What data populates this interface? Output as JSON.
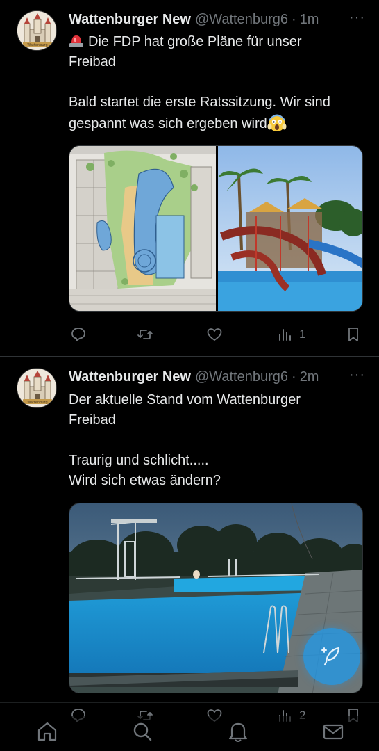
{
  "tweets": [
    {
      "author_name": "Wattenburger New",
      "handle": "@Wattenburg6",
      "separator": "·",
      "time": "1m",
      "more": "···",
      "avatar_label": "Wattenburg",
      "lines": [
        "Die FDP hat große Pläne für unser",
        "Freibad",
        "",
        "Bald startet die erste Ratssitzung. Wir sind",
        "gespannt was sich ergeben wird"
      ],
      "emoji_start": "rotating-light",
      "emoji_end": "face-screaming-in-fear",
      "media": [
        "site-plan-image",
        "water-park-image"
      ],
      "actions": {
        "reply": "",
        "retweet": "",
        "like": "",
        "views": "1",
        "bookmark": ""
      }
    },
    {
      "author_name": "Wattenburger New",
      "handle": "@Wattenburg6",
      "separator": "·",
      "time": "2m",
      "more": "···",
      "avatar_label": "Wattenburg",
      "lines": [
        "Der aktuelle Stand vom Wattenburger",
        "Freibad",
        "",
        "Traurig und schlicht.....",
        "Wird sich etwas ändern?"
      ],
      "media": [
        "old-pool-image"
      ],
      "actions": {
        "reply": "",
        "retweet": "",
        "like": "",
        "views": "2",
        "bookmark": ""
      }
    }
  ],
  "fab": {
    "icon": "compose-feather-icon",
    "color": "#1d9bf0"
  },
  "navbar": {
    "items": [
      "home-icon",
      "search-icon",
      "notifications-icon",
      "messages-icon"
    ]
  },
  "colors": {
    "background": "#000000",
    "text": "#e7e9ea",
    "muted": "#71767b",
    "accent": "#1d9bf0",
    "divider": "#2f3336"
  }
}
